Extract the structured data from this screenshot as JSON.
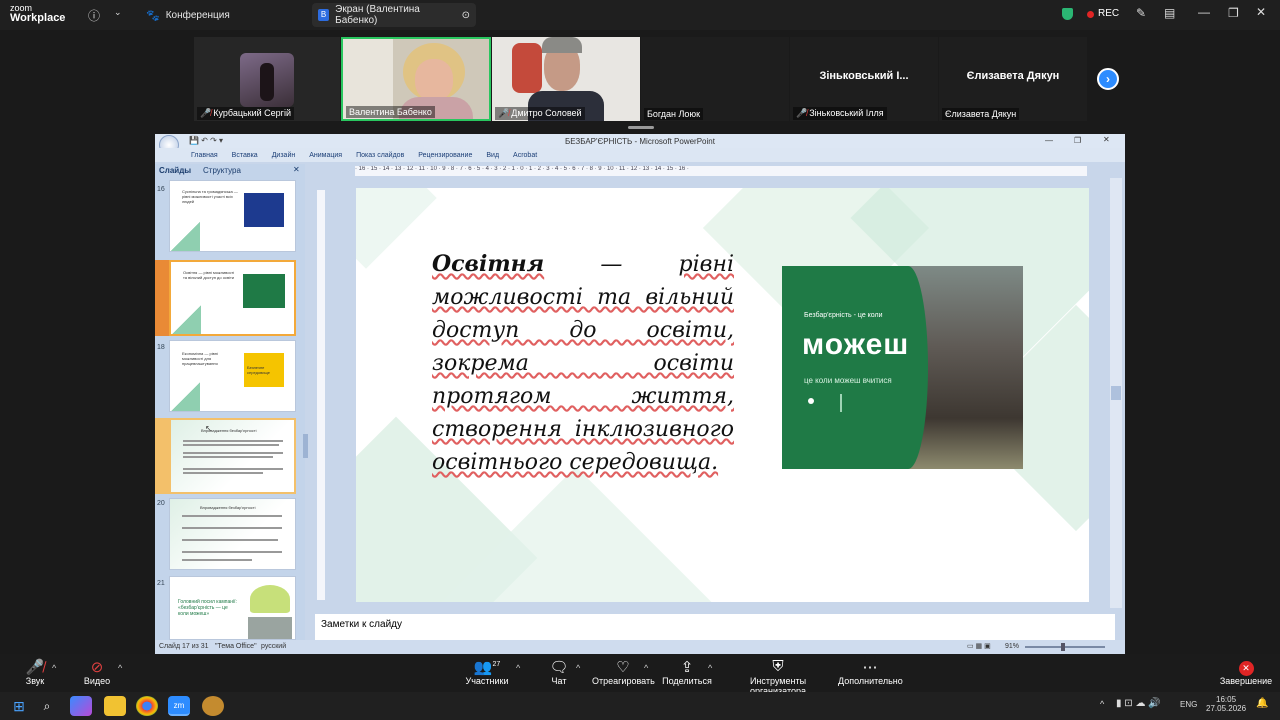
{
  "topbar": {
    "logo_top": "zoom",
    "logo_bottom": "Workplace",
    "conference_tab": "Конференция",
    "screen_tab": "Экран (Валентина Бабенко)",
    "screen_badge": "В",
    "rec": "REC"
  },
  "participants": [
    {
      "name": "Курбацький Сергій",
      "muted": true
    },
    {
      "name": "Валентина Бабенко",
      "muted": false
    },
    {
      "name": "Дмитро Соловей",
      "muted": true
    },
    {
      "name": "Богдан Лоюк",
      "muted": false
    },
    {
      "name": "Зіньковський Ілля",
      "display": "Зіньковський І...",
      "muted": true
    },
    {
      "name": "Єлизавета Дякун",
      "display": "Єлизавета Дякун",
      "muted": false
    }
  ],
  "ppt": {
    "title": "БЕЗБАР'ЄРНІСТЬ - Microsoft PowerPoint",
    "ribbon_tabs": [
      "Главная",
      "Вставка",
      "Дизайн",
      "Анимация",
      "Показ слайдов",
      "Рецензирование",
      "Вид",
      "Acrobat"
    ],
    "pane_tabs": [
      "Слайды",
      "Структура"
    ],
    "thumb_numbers": [
      "16",
      "17",
      "18",
      "19",
      "20",
      "21"
    ],
    "ruler_h": "· 16 · 15 · 14 · 13 · 12 · 11 · 10 · 9 · 8 · 7 · 6 · 5 · 4 · 3 · 2 · 1 · 0 · 1 · 2 · 3 · 4 · 5 · 6 · 7 · 8 · 9 · 10 · 11 · 12 · 13 · 14 · 15 · 16 ·",
    "notes_placeholder": "Заметки к слайду",
    "status_slide": "Слайд 17 из 31",
    "status_theme": "\"Тема Office\"",
    "status_lang": "русский",
    "status_zoom": "91%",
    "slide": {
      "word_bold": "Освітня",
      "dash": "—",
      "body_rest": "рівні можливості та вільний доступ до освіти, зокрема освіти протягом життя, створення інклюзивного освітнього середовища.",
      "image_line1": "Безбар'єрність - це коли",
      "image_brand": "можеш",
      "image_line2": "це коли можеш вчитися"
    },
    "thumb_texts": {
      "t16": "Суспільна та громадянська — рівні можливості участі всіх людей",
      "t17": "Освітня — рівні можливості та вільний доступ до освіти",
      "t18": "Економічна — рівні можливості для працевлаштування",
      "t18_badge": "Безпечне середовище",
      "t19": "Впровадження безбар'єрності",
      "t20": "Впровадження безбар'єрності",
      "t21": "Головний посил кампанії: «безбар'єрність — це коли можеш»"
    }
  },
  "bottombar": {
    "audio": "Звук",
    "video": "Видео",
    "participants": "Участники",
    "participants_count": "27",
    "chat": "Чат",
    "react": "Отреагировать",
    "share": "Поделиться",
    "host_tools": "Инструменты организатора",
    "more": "Дополнительно",
    "end": "Завершение"
  },
  "taskbar": {
    "lang": "ENG",
    "time": "16:05",
    "date": "27.05.2026"
  }
}
